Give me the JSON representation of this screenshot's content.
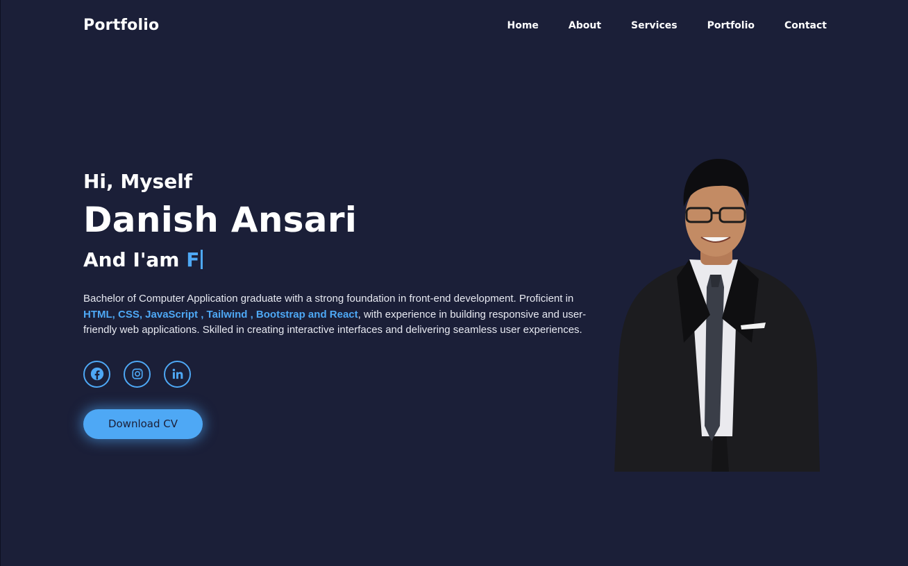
{
  "header": {
    "logo": "Portfolio",
    "nav": [
      {
        "label": "Home"
      },
      {
        "label": "About"
      },
      {
        "label": "Services"
      },
      {
        "label": "Portfolio"
      },
      {
        "label": "Contact"
      }
    ]
  },
  "hero": {
    "greeting": "Hi, Myself",
    "name": "Danish Ansari",
    "role_prefix": "And I'am",
    "role_typed": "F",
    "bio": {
      "part1": "Bachelor of Computer Application graduate with a strong foundation in front-end development. Proficient in ",
      "skills": "HTML, CSS, JavaScript , Tailwind , Bootstrap and React",
      "part2": ", with experience in building responsive and user-friendly web applications. Skilled in creating interactive interfaces and delivering seamless user experiences."
    },
    "socials": [
      {
        "icon": "facebook-icon"
      },
      {
        "icon": "instagram-icon"
      },
      {
        "icon": "linkedin-icon"
      }
    ],
    "cv_button": "Download CV"
  },
  "theme": {
    "background": "#1b1f38",
    "accent": "#4ea8f5",
    "text": "#ffffff"
  }
}
